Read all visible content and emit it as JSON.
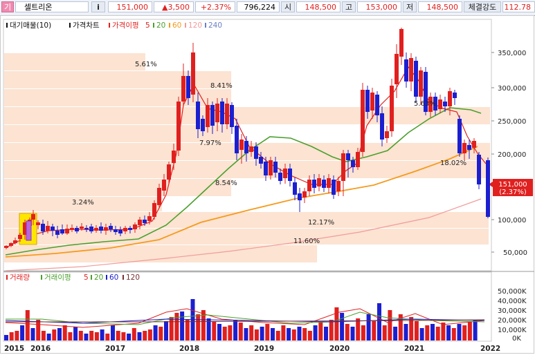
{
  "header": {
    "menu_glyph": "기",
    "stock_name": "셀트리온",
    "info_button": "i",
    "price": "151,000",
    "change": "▲3,500",
    "change_pct": "+2.37%",
    "volume": "796,224",
    "open_label": "시",
    "open_value": "148,500",
    "high_label": "고",
    "high_value": "153,000",
    "low_label": "저",
    "low_value": "148,500",
    "strength_label": "체결강도",
    "strength_value": "112.78"
  },
  "legend_price": {
    "waiting_volume": "대기매물(10)",
    "price_chart": "가격차트",
    "ma_label": "가격이평",
    "ma_periods": [
      "5",
      "20",
      "60",
      "120",
      "240"
    ]
  },
  "legend_volume": {
    "volume": "거래량",
    "ma_label": "거래이평",
    "ma_periods": [
      "5",
      "20",
      "60",
      "120"
    ]
  },
  "colors": {
    "up": "#e0201f",
    "down": "#1c1fcf",
    "ma5": "#e0201f",
    "ma20": "#4aa02c",
    "ma60": "#f59a1b",
    "ma120": "#f29a9a",
    "ma240": "#6b7fc4",
    "supply_band": "#fce3d2",
    "highlight": "#ffe600"
  },
  "price_axis": {
    "ticks": [
      "350,000",
      "300,000",
      "250,000",
      "200,000",
      "150,000",
      "100,000",
      "50,000"
    ],
    "current_price": "151,000",
    "current_pct": "(2.37%)"
  },
  "volume_axis": {
    "ticks": [
      "50,000K",
      "40,000K",
      "30,000K",
      "20,000K",
      "10,000K",
      "0K"
    ]
  },
  "x_axis": {
    "labels": [
      "2015",
      "2016",
      "2017",
      "2018",
      "2019",
      "2020",
      "2021",
      "2022"
    ]
  },
  "supply_pct_labels": [
    "5.61%",
    "8.41%",
    "7.97%",
    "5.63%",
    "18.02%",
    "8.54%",
    "3.24%",
    "12.17%",
    "11.60%"
  ]
}
